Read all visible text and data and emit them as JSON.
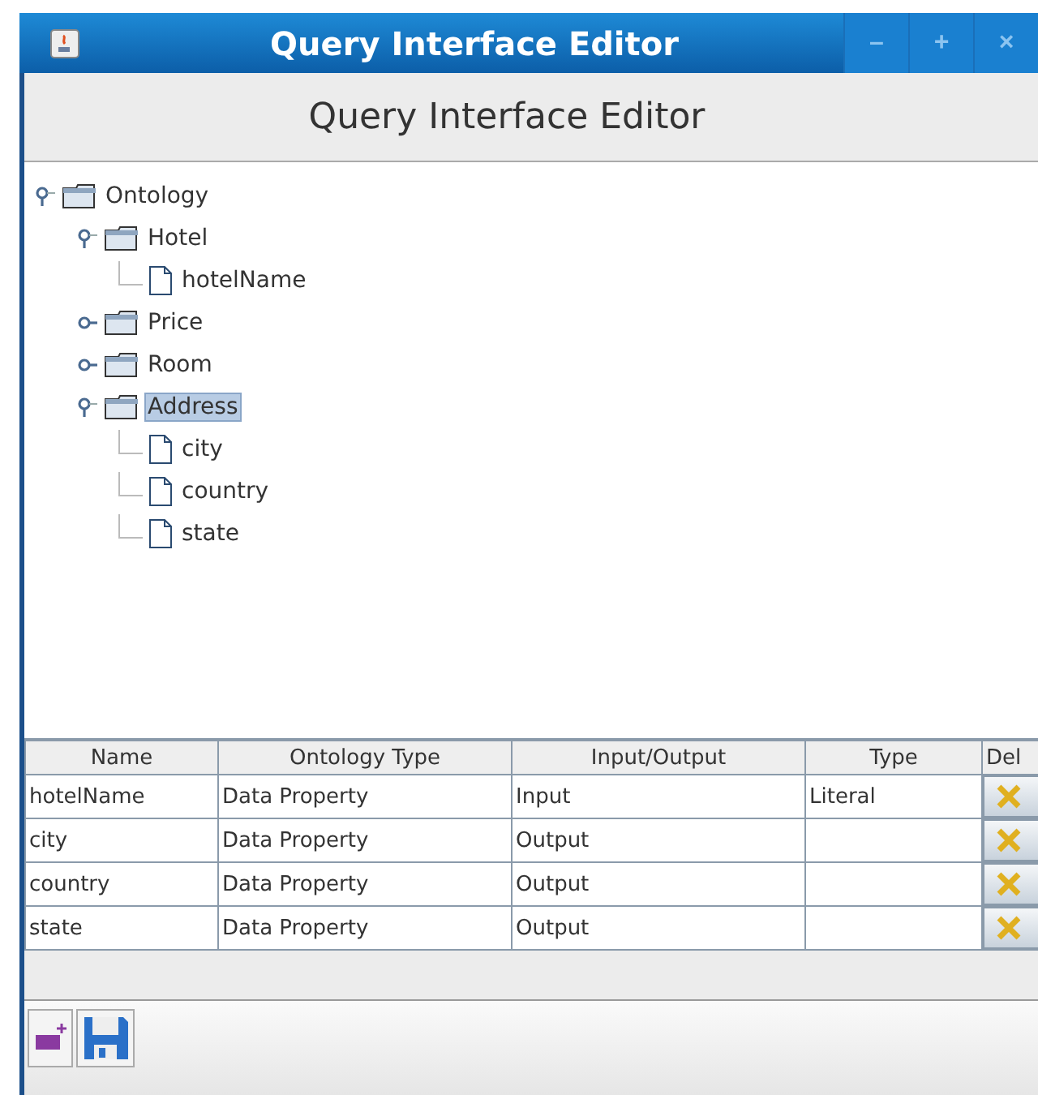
{
  "window": {
    "title": "Query Interface Editor",
    "controls": [
      "–",
      "+",
      "×"
    ]
  },
  "header": {
    "title": "Query Interface Editor"
  },
  "tree": [
    {
      "label": "Ontology",
      "kind": "folder",
      "expanded": true,
      "selected": false,
      "children": [
        {
          "label": "Hotel",
          "kind": "folder",
          "expanded": true,
          "selected": false,
          "children": [
            {
              "label": "hotelName",
              "kind": "file",
              "selected": false
            }
          ]
        },
        {
          "label": "Price",
          "kind": "folder",
          "expanded": false,
          "selected": false
        },
        {
          "label": "Room",
          "kind": "folder",
          "expanded": false,
          "selected": false
        },
        {
          "label": "Address",
          "kind": "folder",
          "expanded": true,
          "selected": true,
          "children": [
            {
              "label": "city",
              "kind": "file",
              "selected": false
            },
            {
              "label": "country",
              "kind": "file",
              "selected": false
            },
            {
              "label": "state",
              "kind": "file",
              "selected": false
            }
          ]
        }
      ]
    }
  ],
  "table": {
    "columns": [
      "Name",
      "Ontology Type",
      "Input/Output",
      "Type",
      "Del"
    ],
    "rows": [
      {
        "cells": [
          "hotelName",
          "Data Property",
          "Input",
          "Literal"
        ]
      },
      {
        "cells": [
          "city",
          "Data Property",
          "Output",
          ""
        ]
      },
      {
        "cells": [
          "country",
          "Data Property",
          "Output",
          ""
        ]
      },
      {
        "cells": [
          "state",
          "Data Property",
          "Output",
          ""
        ]
      }
    ]
  },
  "toolbar": [
    {
      "kind": "add"
    },
    {
      "kind": "save"
    }
  ]
}
